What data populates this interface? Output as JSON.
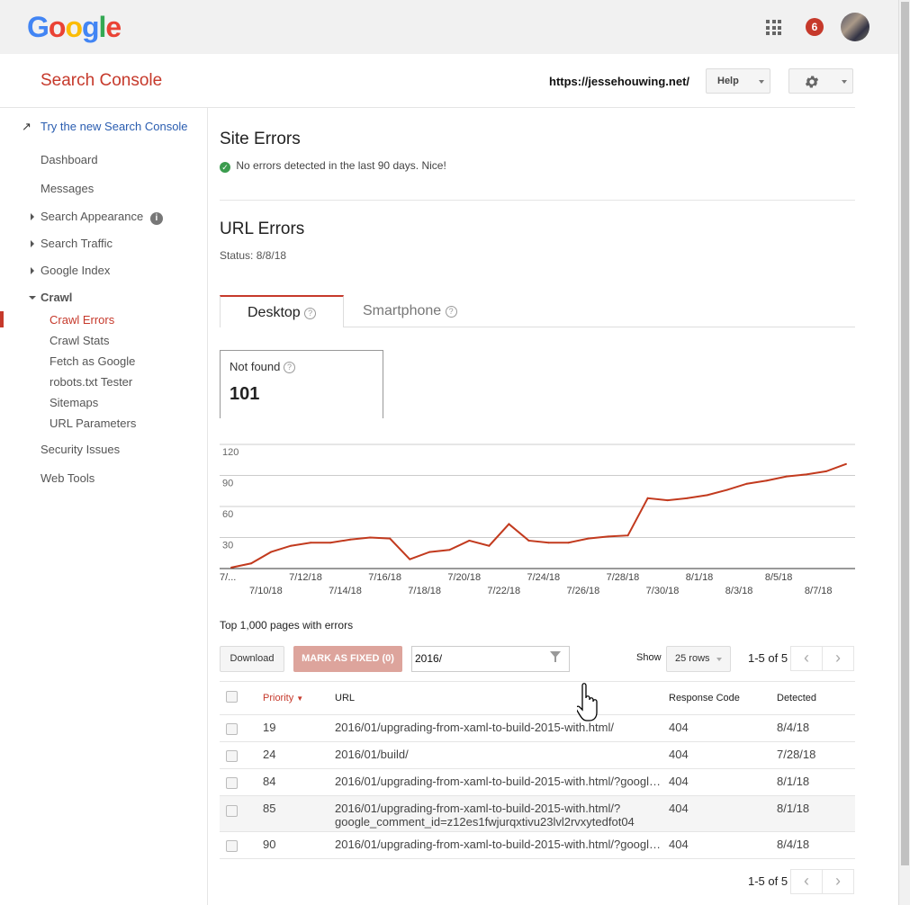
{
  "header": {
    "logo": "Google",
    "notifications": "6",
    "app_title": "Search Console",
    "site": "https://jessehouwing.net/",
    "help_label": "Help"
  },
  "sidebar": {
    "new_console": "Try the new Search Console",
    "items": [
      {
        "label": "Dashboard"
      },
      {
        "label": "Messages"
      },
      {
        "label": "Search Appearance"
      },
      {
        "label": "Search Traffic"
      },
      {
        "label": "Google Index"
      },
      {
        "label": "Crawl"
      },
      {
        "label": "Crawl Errors"
      },
      {
        "label": "Crawl Stats"
      },
      {
        "label": "Fetch as Google"
      },
      {
        "label": "robots.txt Tester"
      },
      {
        "label": "Sitemaps"
      },
      {
        "label": "URL Parameters"
      },
      {
        "label": "Security Issues"
      },
      {
        "label": "Web Tools"
      }
    ]
  },
  "site_errors": {
    "title": "Site Errors",
    "message": "No errors detected in the last 90 days. Nice!"
  },
  "url_errors": {
    "title": "URL Errors",
    "status": "Status: 8/8/18",
    "tabs": [
      "Desktop",
      "Smartphone"
    ],
    "card_label": "Not found",
    "card_value": "101"
  },
  "chart_data": {
    "type": "line",
    "title": "",
    "xlabel": "",
    "ylabel": "",
    "ylim": [
      0,
      120
    ],
    "yticks": [
      30,
      60,
      90,
      120
    ],
    "x": [
      "7/8/18",
      "7/9/18",
      "7/10/18",
      "7/11/18",
      "7/12/18",
      "7/13/18",
      "7/14/18",
      "7/15/18",
      "7/16/18",
      "7/17/18",
      "7/18/18",
      "7/19/18",
      "7/20/18",
      "7/21/18",
      "7/22/18",
      "7/23/18",
      "7/24/18",
      "7/25/18",
      "7/26/18",
      "7/27/18",
      "7/28/18",
      "7/29/18",
      "7/30/18",
      "7/31/18",
      "8/1/18",
      "8/2/18",
      "8/3/18",
      "8/4/18",
      "8/5/18",
      "8/6/18",
      "8/7/18",
      "8/8/18"
    ],
    "series": [
      {
        "name": "Not found",
        "color": "#c23a1e",
        "values": [
          1,
          5,
          16,
          22,
          25,
          25,
          28,
          30,
          29,
          9,
          16,
          18,
          27,
          22,
          43,
          27,
          25,
          25,
          29,
          31,
          32,
          68,
          66,
          68,
          71,
          76,
          82,
          85,
          89,
          91,
          94,
          101
        ]
      }
    ],
    "xticks_top": [
      "7/...",
      "7/12/18",
      "7/16/18",
      "7/20/18",
      "7/24/18",
      "7/28/18",
      "8/1/18",
      "8/5/18"
    ],
    "xticks_bottom": [
      "7/10/18",
      "7/14/18",
      "7/18/18",
      "7/22/18",
      "7/26/18",
      "7/30/18",
      "8/3/18",
      "8/7/18"
    ],
    "grid": true
  },
  "table": {
    "title": "Top 1,000 pages with errors",
    "download": "Download",
    "mark_fixed": "MARK AS FIXED (0)",
    "filter_value": "2016/",
    "show_label": "Show",
    "rows_select": "25 rows",
    "pagination": "1-5 of 5",
    "columns": [
      "Priority",
      "URL",
      "Response Code",
      "Detected"
    ],
    "rows": [
      {
        "priority": "19",
        "url": "2016/01/upgrading-from-xaml-to-build-2015-with.html/",
        "code": "404",
        "detected": "8/4/18"
      },
      {
        "priority": "24",
        "url": "2016/01/build/",
        "code": "404",
        "detected": "7/28/18"
      },
      {
        "priority": "84",
        "url": "2016/01/upgrading-from-xaml-to-build-2015-with.html/?googl…",
        "code": "404",
        "detected": "8/1/18"
      },
      {
        "priority": "85",
        "url": "2016/01/upgrading-from-xaml-to-build-2015-with.html/?",
        "url2": "google_comment_id=z12es1fwjurqxtivu23lvl2rvxytedfot04",
        "code": "404",
        "detected": "8/1/18"
      },
      {
        "priority": "90",
        "url": "2016/01/upgrading-from-xaml-to-build-2015-with.html/?googl…",
        "code": "404",
        "detected": "8/4/18"
      }
    ]
  }
}
